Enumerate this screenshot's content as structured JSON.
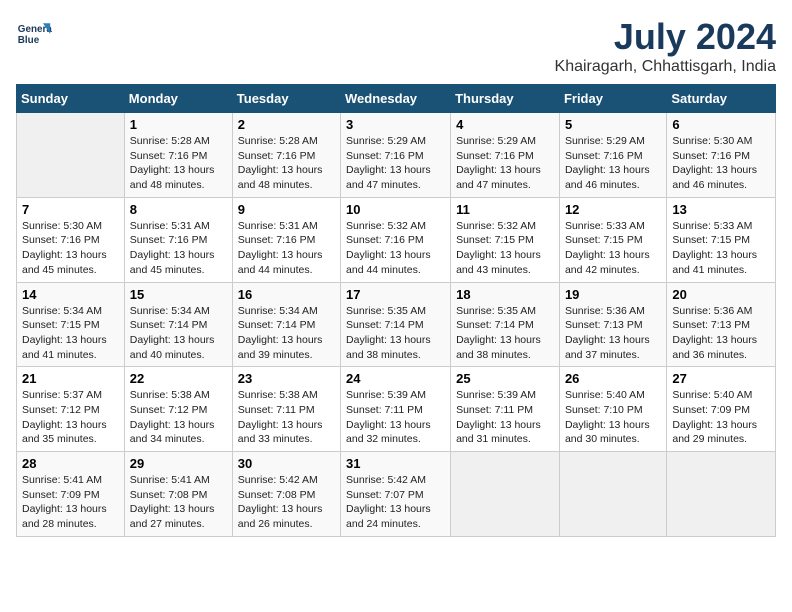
{
  "header": {
    "logo_line1": "General",
    "logo_line2": "Blue",
    "month": "July 2024",
    "location": "Khairagarh, Chhattisgarh, India"
  },
  "weekdays": [
    "Sunday",
    "Monday",
    "Tuesday",
    "Wednesday",
    "Thursday",
    "Friday",
    "Saturday"
  ],
  "weeks": [
    [
      {
        "day": "",
        "info": ""
      },
      {
        "day": "1",
        "info": "Sunrise: 5:28 AM\nSunset: 7:16 PM\nDaylight: 13 hours\nand 48 minutes."
      },
      {
        "day": "2",
        "info": "Sunrise: 5:28 AM\nSunset: 7:16 PM\nDaylight: 13 hours\nand 48 minutes."
      },
      {
        "day": "3",
        "info": "Sunrise: 5:29 AM\nSunset: 7:16 PM\nDaylight: 13 hours\nand 47 minutes."
      },
      {
        "day": "4",
        "info": "Sunrise: 5:29 AM\nSunset: 7:16 PM\nDaylight: 13 hours\nand 47 minutes."
      },
      {
        "day": "5",
        "info": "Sunrise: 5:29 AM\nSunset: 7:16 PM\nDaylight: 13 hours\nand 46 minutes."
      },
      {
        "day": "6",
        "info": "Sunrise: 5:30 AM\nSunset: 7:16 PM\nDaylight: 13 hours\nand 46 minutes."
      }
    ],
    [
      {
        "day": "7",
        "info": "Sunrise: 5:30 AM\nSunset: 7:16 PM\nDaylight: 13 hours\nand 45 minutes."
      },
      {
        "day": "8",
        "info": "Sunrise: 5:31 AM\nSunset: 7:16 PM\nDaylight: 13 hours\nand 45 minutes."
      },
      {
        "day": "9",
        "info": "Sunrise: 5:31 AM\nSunset: 7:16 PM\nDaylight: 13 hours\nand 44 minutes."
      },
      {
        "day": "10",
        "info": "Sunrise: 5:32 AM\nSunset: 7:16 PM\nDaylight: 13 hours\nand 44 minutes."
      },
      {
        "day": "11",
        "info": "Sunrise: 5:32 AM\nSunset: 7:15 PM\nDaylight: 13 hours\nand 43 minutes."
      },
      {
        "day": "12",
        "info": "Sunrise: 5:33 AM\nSunset: 7:15 PM\nDaylight: 13 hours\nand 42 minutes."
      },
      {
        "day": "13",
        "info": "Sunrise: 5:33 AM\nSunset: 7:15 PM\nDaylight: 13 hours\nand 41 minutes."
      }
    ],
    [
      {
        "day": "14",
        "info": "Sunrise: 5:34 AM\nSunset: 7:15 PM\nDaylight: 13 hours\nand 41 minutes."
      },
      {
        "day": "15",
        "info": "Sunrise: 5:34 AM\nSunset: 7:14 PM\nDaylight: 13 hours\nand 40 minutes."
      },
      {
        "day": "16",
        "info": "Sunrise: 5:34 AM\nSunset: 7:14 PM\nDaylight: 13 hours\nand 39 minutes."
      },
      {
        "day": "17",
        "info": "Sunrise: 5:35 AM\nSunset: 7:14 PM\nDaylight: 13 hours\nand 38 minutes."
      },
      {
        "day": "18",
        "info": "Sunrise: 5:35 AM\nSunset: 7:14 PM\nDaylight: 13 hours\nand 38 minutes."
      },
      {
        "day": "19",
        "info": "Sunrise: 5:36 AM\nSunset: 7:13 PM\nDaylight: 13 hours\nand 37 minutes."
      },
      {
        "day": "20",
        "info": "Sunrise: 5:36 AM\nSunset: 7:13 PM\nDaylight: 13 hours\nand 36 minutes."
      }
    ],
    [
      {
        "day": "21",
        "info": "Sunrise: 5:37 AM\nSunset: 7:12 PM\nDaylight: 13 hours\nand 35 minutes."
      },
      {
        "day": "22",
        "info": "Sunrise: 5:38 AM\nSunset: 7:12 PM\nDaylight: 13 hours\nand 34 minutes."
      },
      {
        "day": "23",
        "info": "Sunrise: 5:38 AM\nSunset: 7:11 PM\nDaylight: 13 hours\nand 33 minutes."
      },
      {
        "day": "24",
        "info": "Sunrise: 5:39 AM\nSunset: 7:11 PM\nDaylight: 13 hours\nand 32 minutes."
      },
      {
        "day": "25",
        "info": "Sunrise: 5:39 AM\nSunset: 7:11 PM\nDaylight: 13 hours\nand 31 minutes."
      },
      {
        "day": "26",
        "info": "Sunrise: 5:40 AM\nSunset: 7:10 PM\nDaylight: 13 hours\nand 30 minutes."
      },
      {
        "day": "27",
        "info": "Sunrise: 5:40 AM\nSunset: 7:09 PM\nDaylight: 13 hours\nand 29 minutes."
      }
    ],
    [
      {
        "day": "28",
        "info": "Sunrise: 5:41 AM\nSunset: 7:09 PM\nDaylight: 13 hours\nand 28 minutes."
      },
      {
        "day": "29",
        "info": "Sunrise: 5:41 AM\nSunset: 7:08 PM\nDaylight: 13 hours\nand 27 minutes."
      },
      {
        "day": "30",
        "info": "Sunrise: 5:42 AM\nSunset: 7:08 PM\nDaylight: 13 hours\nand 26 minutes."
      },
      {
        "day": "31",
        "info": "Sunrise: 5:42 AM\nSunset: 7:07 PM\nDaylight: 13 hours\nand 24 minutes."
      },
      {
        "day": "",
        "info": ""
      },
      {
        "day": "",
        "info": ""
      },
      {
        "day": "",
        "info": ""
      }
    ]
  ]
}
